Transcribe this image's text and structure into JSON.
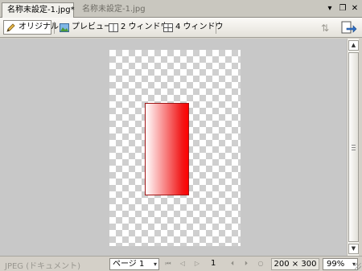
{
  "tabs": [
    {
      "label": "名称未設定-1.jpg*",
      "active": true
    },
    {
      "label": "名称未設定-1.jpg",
      "active": false
    }
  ],
  "window_controls": {
    "minimize": "▾",
    "restore": "❐",
    "close": "✕"
  },
  "view_modes": [
    {
      "label": "オリジナル",
      "icon": "pencil-icon",
      "active": true
    },
    {
      "label": "プレビュー",
      "icon": "picture-icon",
      "active": false
    },
    {
      "label": "2 ウィンドウ",
      "icon": "two-window-icon",
      "active": false
    },
    {
      "label": "4 ウィンドウ",
      "icon": "four-window-icon",
      "active": false
    }
  ],
  "toolbar_right": {
    "tool_a_glyph": "⇅",
    "tool_b_icon": "export-icon"
  },
  "canvas": {
    "checker_color": "#cfcfcf",
    "shape_fill_from": "#ffffff",
    "shape_fill_to": "#ff0000",
    "shape_border": "#a01414"
  },
  "scrollbar": {
    "up": "▲",
    "down": "▼"
  },
  "status": {
    "format_text": "JPEG (ドキュメント)",
    "page_select": "ページ 1",
    "page_number": "1",
    "image_size": "200 × 300",
    "zoom": "99%",
    "dropdown_arrow": "▾",
    "nav": {
      "first": "⏮",
      "prev": "◁",
      "next": "▷",
      "back": "⏴",
      "fwd": "⏵",
      "stop": "○"
    }
  }
}
